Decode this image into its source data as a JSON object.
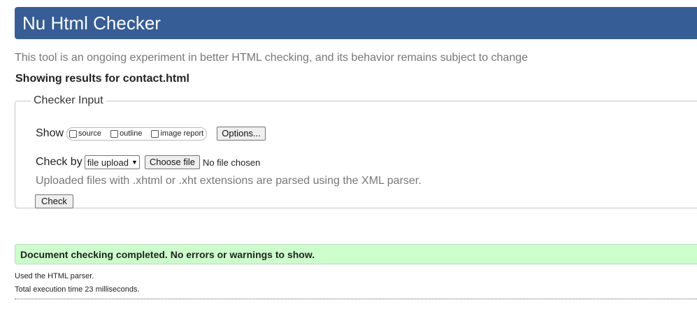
{
  "header": {
    "title": "Nu Html Checker"
  },
  "intro": "This tool is an ongoing experiment in better HTML checking, and its behavior remains subject to change",
  "results_for": "Showing results for contact.html",
  "checker_input": {
    "legend": "Checker Input",
    "show_label": "Show",
    "show_options": [
      {
        "label": "source",
        "checked": false
      },
      {
        "label": "outline",
        "checked": false
      },
      {
        "label": "image report",
        "checked": false
      }
    ],
    "options_button": "Options...",
    "check_by_label": "Check by",
    "check_by_selected": "file upload",
    "choose_file_button": "Choose file",
    "no_file_text": "No file chosen",
    "note": "Uploaded files with .xhtml or .xht extensions are parsed using the XML parser.",
    "check_button": "Check"
  },
  "result": {
    "message": "Document checking completed. No errors or warnings to show.",
    "parser_note": "Used the HTML parser.",
    "timing": "Total execution time 23 milliseconds."
  },
  "colors": {
    "banner": "#365d95",
    "success_bg": "#ccffcc"
  }
}
